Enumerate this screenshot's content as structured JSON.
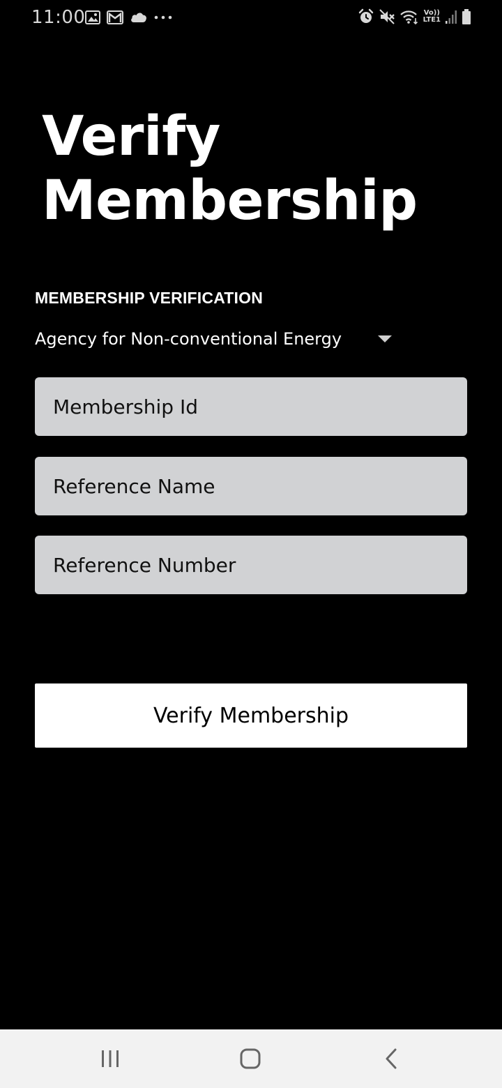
{
  "status_bar": {
    "time": "11:00",
    "left_icons": [
      "gallery-icon",
      "gmail-icon",
      "cloud-icon",
      "more-dots-icon"
    ],
    "right_icons": [
      "alarm-icon",
      "mute-icon",
      "wifi-icon",
      "volte-lte-icon",
      "signal-icon",
      "battery-icon"
    ],
    "volte_text": "Vo))",
    "lte_text": "LTE1"
  },
  "page": {
    "title_line1": "Verify",
    "title_line2": "Membership",
    "section_label": "MEMBERSHIP VERIFICATION",
    "agency_select": {
      "selected": "Agency for Non-conventional Energy"
    },
    "fields": {
      "membership_id": {
        "placeholder": "Membership Id",
        "value": ""
      },
      "reference_name": {
        "placeholder": "Reference Name",
        "value": ""
      },
      "reference_number": {
        "placeholder": "Reference Number",
        "value": ""
      }
    },
    "verify_button_label": "Verify Membership"
  },
  "nav_bar": {
    "buttons": [
      "recents-icon",
      "home-icon",
      "back-icon"
    ]
  },
  "colors": {
    "background": "#000000",
    "text": "#ffffff",
    "field_background": "#d1d2d4",
    "button_background": "#ffffff",
    "nav_background": "#f2f2f2"
  }
}
